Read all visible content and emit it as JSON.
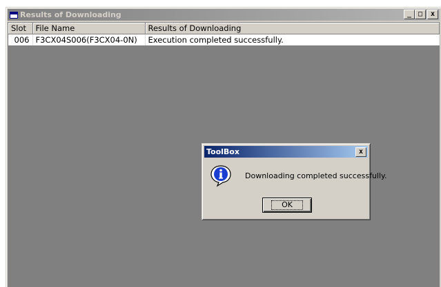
{
  "window": {
    "title": "Results of Downloading",
    "buttons": {
      "minimize": "_",
      "maximize": "□",
      "close": "x"
    }
  },
  "table": {
    "columns": [
      "Slot",
      "File Name",
      "Results of Downloading"
    ],
    "rows": [
      {
        "slot": "006",
        "file_name": "F3CX04S006(F3CX04-0N)",
        "result": "Execution completed successfully."
      }
    ]
  },
  "dialog": {
    "title": "ToolBox",
    "close": "x",
    "icon": "information-icon",
    "message": "Downloading completed successfully.",
    "ok_label": "OK"
  },
  "colors": {
    "inactive_titlebar": "#808080",
    "active_titlebar": "#0a246a",
    "client_background": "#808080",
    "face": "#d4d0c8"
  }
}
